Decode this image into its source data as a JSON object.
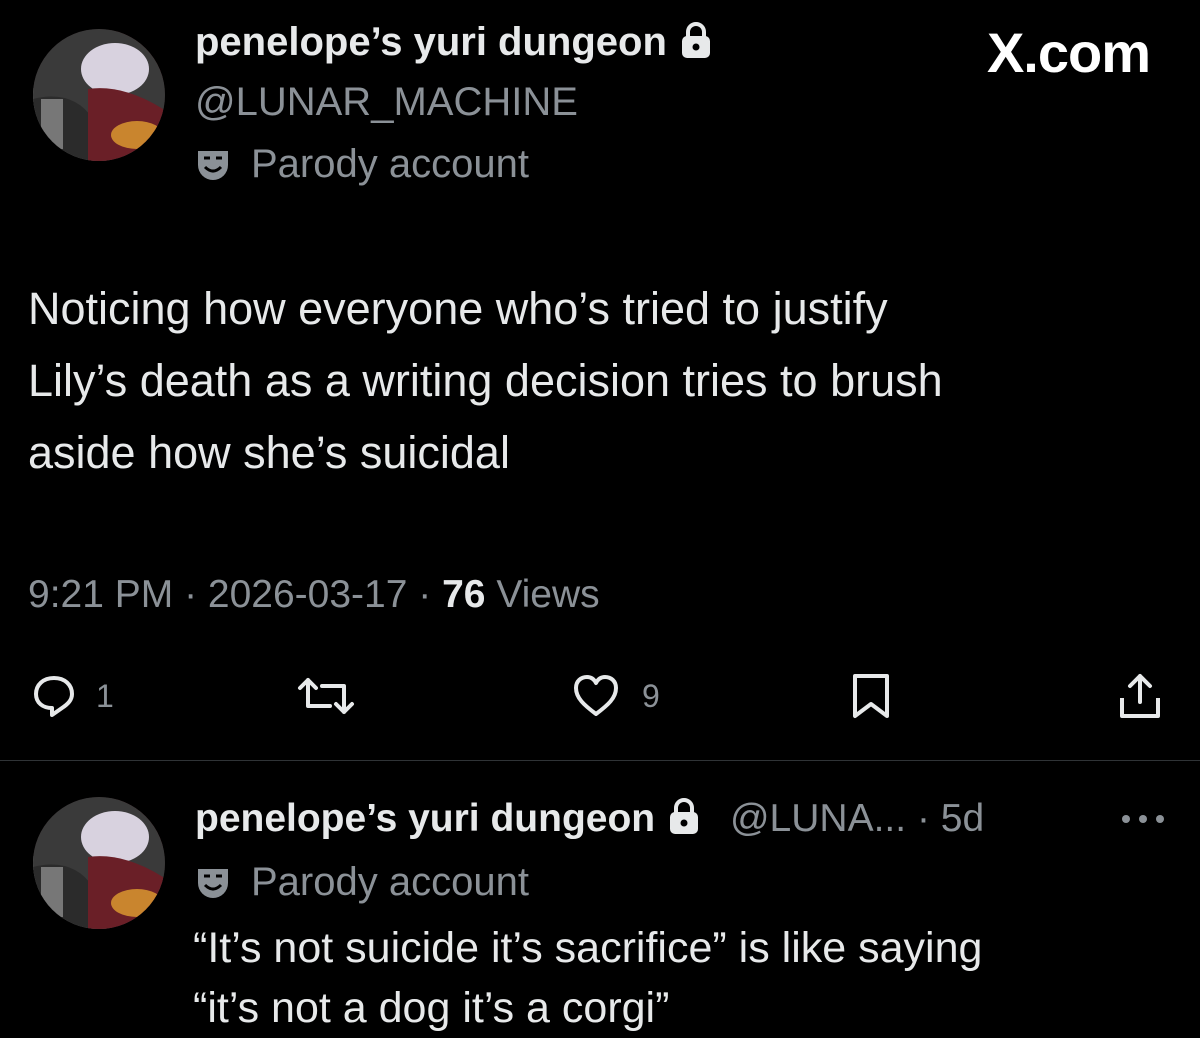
{
  "site": "X.com",
  "tweet": {
    "display_name": "penelope’s yuri dungeon",
    "handle": "@LUNAR_MACHINE",
    "label": "Parody account",
    "text_lines": [
      "Noticing how everyone who’s tried to justify",
      "Lily’s death as a writing decision tries to brush",
      "aside how she’s suicidal"
    ],
    "time": "9:21 PM",
    "date": "2026-03-17",
    "views_count": "76",
    "views_label": "Views",
    "replies": "1",
    "likes": "9"
  },
  "reply": {
    "display_name": "penelope’s yuri dungeon",
    "handle": "@LUNA...",
    "age": "5d",
    "label": "Parody account",
    "text_lines": [
      "“It’s not suicide it’s sacrifice” is like saying",
      "“it’s not a dog it’s a corgi”"
    ]
  },
  "icons": [
    "lock-icon",
    "parody-mask-icon",
    "reply-icon",
    "retweet-icon",
    "like-icon",
    "bookmark-icon",
    "share-icon",
    "more-icon"
  ]
}
